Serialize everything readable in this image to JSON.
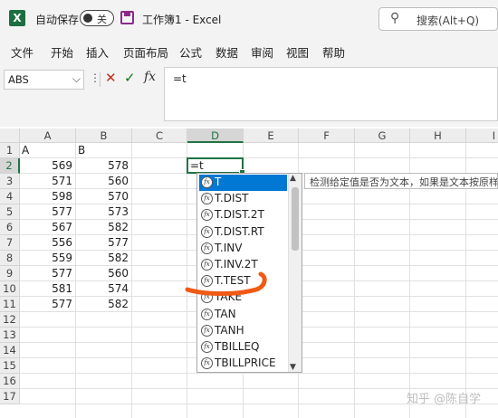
{
  "titlebar": {
    "logo": "X",
    "autosave_label": "自动保存",
    "autosave_state": "关",
    "doc_title": "工作簿1  -  Excel",
    "search_placeholder": "搜索(Alt+Q)"
  },
  "ribbon": {
    "tabs": [
      "文件",
      "开始",
      "插入",
      "页面布局",
      "公式",
      "数据",
      "审阅",
      "视图",
      "帮助"
    ]
  },
  "formula_bar": {
    "name_box": "ABS",
    "dots": "⋮",
    "cancel": "✕",
    "enter": "✓",
    "fx": "fx",
    "formula": "=t"
  },
  "sheet": {
    "columns": [
      "A",
      "B",
      "C",
      "D",
      "E",
      "F",
      "G",
      "H",
      "I"
    ],
    "rows": [
      "1",
      "2",
      "3",
      "4",
      "5",
      "6",
      "7",
      "8",
      "9",
      "10",
      "11",
      "12",
      "13",
      "14",
      "15",
      "16",
      "17"
    ],
    "headers": {
      "A": "A",
      "B": "B"
    },
    "col_a": [
      569,
      571,
      598,
      577,
      567,
      556,
      559,
      577,
      581,
      577
    ],
    "col_b": [
      578,
      560,
      570,
      573,
      582,
      577,
      582,
      560,
      574,
      582
    ],
    "active_cell": "D2",
    "active_value": "=t"
  },
  "autocomplete": {
    "items": [
      "T",
      "T.DIST",
      "T.DIST.2T",
      "T.DIST.RT",
      "T.INV",
      "T.INV.2T",
      "T.TEST",
      "TAKE",
      "TAN",
      "TANH",
      "TBILLEQ",
      "TBILLPRICE"
    ],
    "selected_index": 0,
    "tooltip": "检测给定值是否为文本，如果是文本按原样返"
  },
  "colors": {
    "excel_green": "#217346",
    "selection_blue": "#0078d4",
    "annotation_orange": "#f05a14"
  },
  "watermark": "知乎 @陈自学"
}
